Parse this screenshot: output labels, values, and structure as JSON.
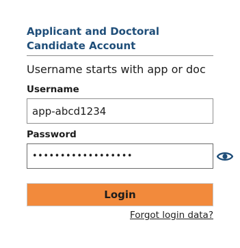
{
  "login": {
    "heading": "Applicant and Doctoral Candidate Account",
    "hint": "Username starts with app or doc",
    "username_label": "Username",
    "username_value": "app-abcd1234",
    "password_label": "Password",
    "password_value": "••••••••••••••••••",
    "show_password_icon": "eye-icon",
    "login_button": "Login",
    "forgot_link": "Forgot login data?"
  },
  "colors": {
    "heading": "#1f4e79",
    "login_button_bg": "#f28a3c",
    "eye_icon": "#1f4e79"
  }
}
